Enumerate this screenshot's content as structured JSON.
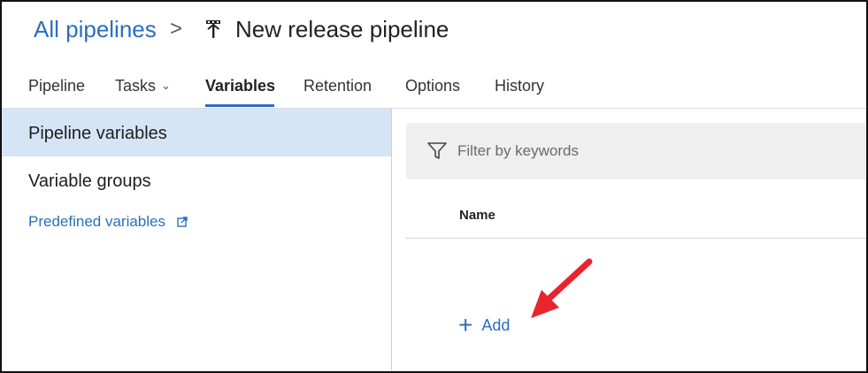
{
  "breadcrumb": {
    "parent": "All pipelines",
    "separator": ">",
    "title": "New release pipeline",
    "title_icon": "pipeline-icon"
  },
  "tabs": [
    {
      "label": "Pipeline",
      "active": false
    },
    {
      "label": "Tasks",
      "active": false,
      "dropdown": true
    },
    {
      "label": "Variables",
      "active": true
    },
    {
      "label": "Retention",
      "active": false
    },
    {
      "label": "Options",
      "active": false
    },
    {
      "label": "History",
      "active": false
    }
  ],
  "sidebar": {
    "items": [
      {
        "label": "Pipeline variables",
        "selected": true
      },
      {
        "label": "Variable groups",
        "selected": false
      }
    ],
    "link": "Predefined variables",
    "link_icon": "external-link-icon"
  },
  "filter": {
    "placeholder": "Filter by keywords",
    "icon": "filter-icon"
  },
  "table": {
    "columns": [
      "Name"
    ]
  },
  "add_button": {
    "label": "Add",
    "icon": "plus-icon"
  },
  "colors": {
    "accent": "#2a6ebd",
    "selected_bg": "#d6e5f5",
    "annotation_arrow": "#e8242c"
  }
}
